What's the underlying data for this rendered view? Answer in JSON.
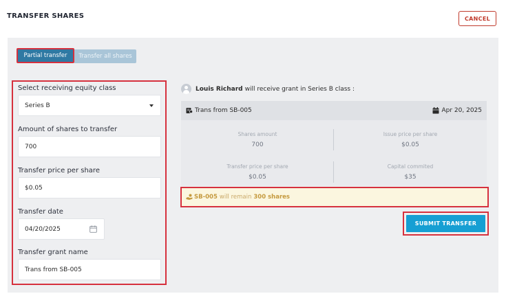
{
  "header": {
    "title": "TRANSFER SHARES",
    "cancel_label": "CANCEL"
  },
  "tabs": [
    {
      "label": "Partial transfer",
      "active": true
    },
    {
      "label": "Transfer all shares",
      "active": false
    }
  ],
  "form": {
    "equity_class": {
      "label": "Select receiving equity class",
      "value": "Series B"
    },
    "amount": {
      "label": "Amount of shares to transfer",
      "value": "700"
    },
    "price": {
      "label": "Transfer price per share",
      "value": "$0.05"
    },
    "date": {
      "label": "Transfer date",
      "value": "04/20/2025"
    },
    "grant_name": {
      "label": "Transfer grant name",
      "value": "Trans from SB-005"
    }
  },
  "summary": {
    "recipient_name": "Louis Richard",
    "recipient_text": "will receive grant in Series B class :",
    "grant_title": "Trans from SB-005",
    "grant_date": "Apr 20, 2025",
    "details": [
      {
        "label": "Shares amount",
        "value": "700"
      },
      {
        "label": "Issue price per share",
        "value": "$0.05"
      },
      {
        "label": "Transfer price per share",
        "value": "$0.05"
      },
      {
        "label": "Capital commited",
        "value": "$35"
      }
    ],
    "remain": {
      "source": "SB-005",
      "middle": "will remain",
      "amount": "300 shares"
    }
  },
  "submit_label": "SUBMIT TRANSFER",
  "colors": {
    "accent_blue": "#169fd3",
    "active_tab": "#2f79a3",
    "cancel_red": "#c0392b",
    "highlight_outline": "#d6303d",
    "notice_bg": "#fbf6df"
  },
  "icons": [
    "person-icon",
    "certificate-icon",
    "calendar-icon",
    "hand-coins-icon",
    "chevron-down-icon"
  ]
}
